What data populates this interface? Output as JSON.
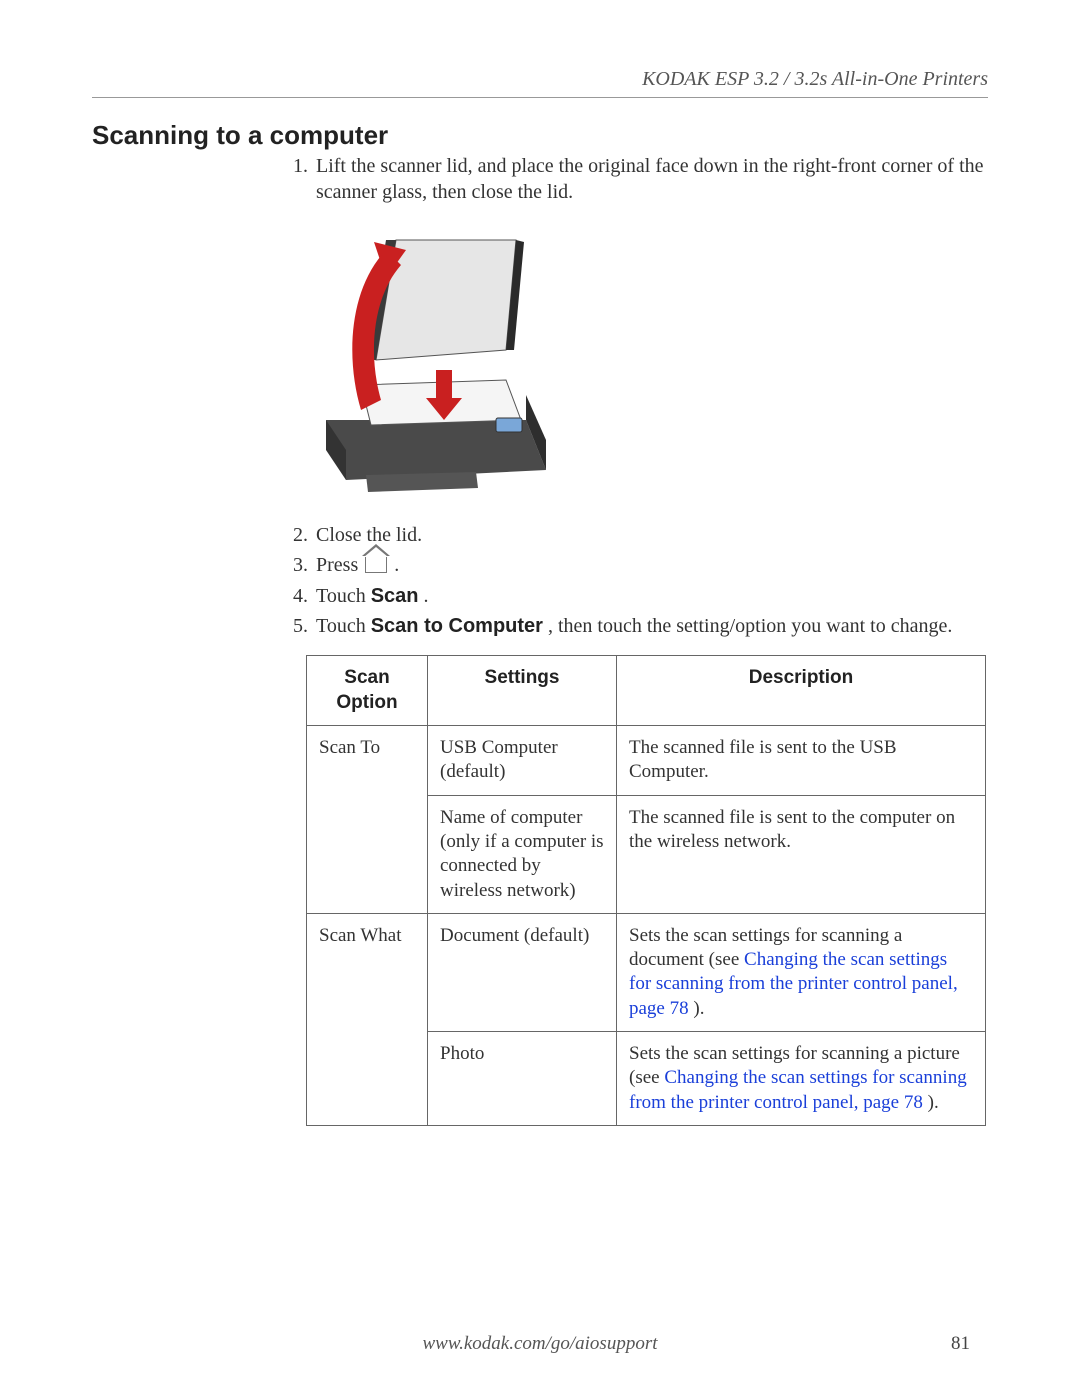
{
  "header": {
    "running_head": "KODAK ESP 3.2 / 3.2s All-in-One Printers"
  },
  "section": {
    "title": "Scanning to a computer"
  },
  "steps": {
    "s1_num": "1.",
    "s1_text": "Lift the scanner lid, and place the original face down in the right-front corner of the scanner glass, then close the lid.",
    "s2_num": "2.",
    "s2_text": "Close the lid.",
    "s3_num": "3.",
    "s3_text_a": "Press ",
    "s3_text_b": ".",
    "s4_num": "4.",
    "s4_text_a": "Touch ",
    "s4_text_b": "Scan",
    "s4_text_c": ".",
    "s5_num": "5.",
    "s5_text_a": "Touch ",
    "s5_text_b": "Scan to Computer",
    "s5_text_c": ", then touch the setting/option you want to change."
  },
  "table": {
    "h1": "Scan Option",
    "h2": "Settings",
    "h3": "Description",
    "r1c1": "Scan To",
    "r1c2": "USB Computer (default)",
    "r1c3": "The scanned file is sent to the USB Computer.",
    "r2c2": "Name of computer (only if a computer is connected by wireless network)",
    "r2c3": "The scanned file is sent to the computer on the wireless network.",
    "r3c1": "Scan What",
    "r3c2": "Document (default)",
    "r3c3_a": "Sets the scan settings for scanning a document (see ",
    "r3c3_link": "Changing the scan settings for scanning from the printer control panel, page 78",
    "r3c3_b": ").",
    "r4c2": "Photo",
    "r4c3_a": "Sets the scan settings for scanning a picture (see ",
    "r4c3_link": "Changing the scan settings for scanning from the printer control panel, page 78",
    "r4c3_b": ")."
  },
  "footer": {
    "url": "www.kodak.com/go/aiosupport",
    "page": "81"
  }
}
